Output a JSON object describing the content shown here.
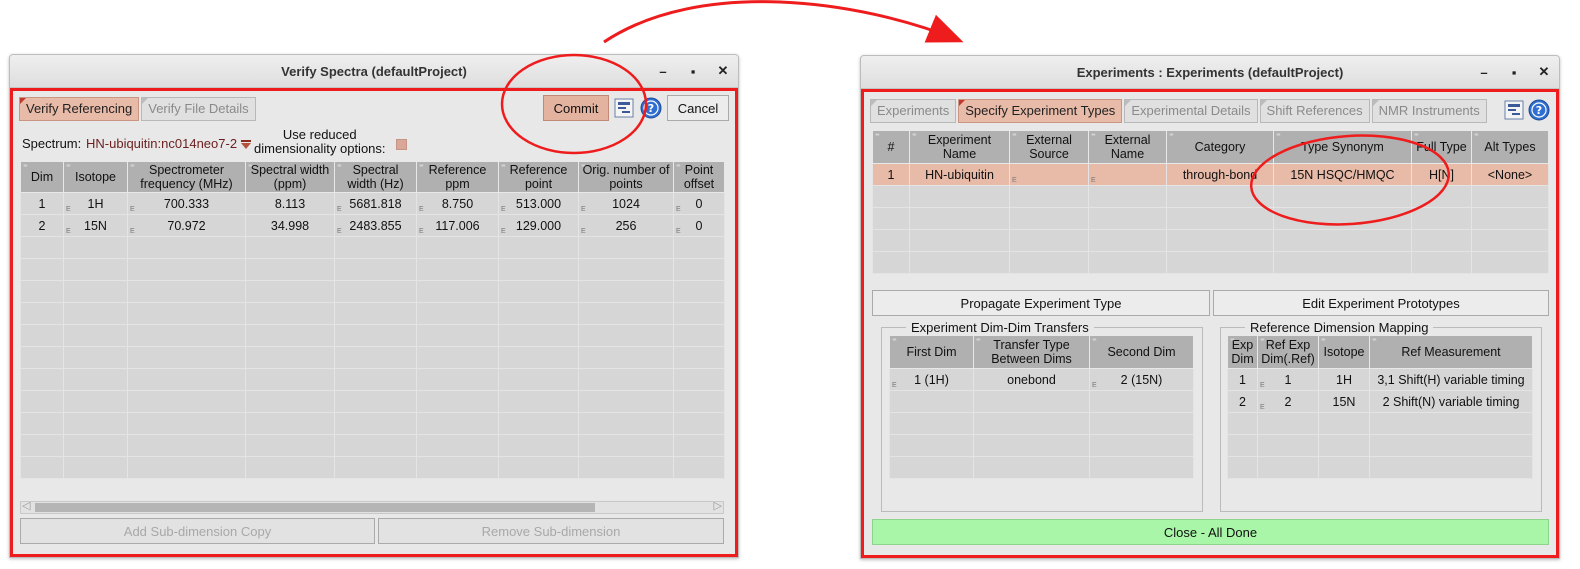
{
  "left": {
    "title": "Verify Spectra (defaultProject)",
    "win_minimize": "–",
    "win_maximize": "▪",
    "win_close": "✕",
    "tabs": [
      "Verify Referencing",
      "Verify File Details"
    ],
    "commit_label": "Commit",
    "cancel_label": "Cancel",
    "spectrum_label": "Spectrum:",
    "spectrum_value": "HN-ubiquitin:nc014neo7-2",
    "reduced_label": "Use reduced\ndimensionality options:",
    "columns": [
      "Dim",
      "Isotope",
      "Spectrometer frequency (MHz)",
      "Spectral width (ppm)",
      "Spectral width (Hz)",
      "Reference ppm",
      "Reference point",
      "Orig. number of points",
      "Point offset"
    ],
    "rows": [
      [
        "1",
        "1H",
        "700.333",
        "8.113",
        "5681.818",
        "8.750",
        "513.000",
        "1024",
        "0"
      ],
      [
        "2",
        "15N",
        "70.972",
        "34.998",
        "2483.855",
        "117.006",
        "129.000",
        "256",
        "0"
      ]
    ],
    "add_subdim_label": "Add Sub-dimension Copy",
    "remove_subdim_label": "Remove Sub-dimension",
    "scroll_left": "◁",
    "scroll_right": "▷"
  },
  "right": {
    "title": "Experiments : Experiments (defaultProject)",
    "win_minimize": "–",
    "win_maximize": "▪",
    "win_close": "✕",
    "tabs": [
      "Experiments",
      "Specify Experiment Types",
      "Experimental Details",
      "Shift References",
      "NMR Instruments"
    ],
    "columns": [
      "#",
      "Experiment Name",
      "External Source",
      "External Name",
      "Category",
      "Type Synonym",
      "Full Type",
      "Alt Types"
    ],
    "rows": [
      [
        "1",
        "HN-ubiquitin",
        "",
        "",
        "through-bond",
        "15N HSQC/HMQC",
        "H[N]",
        "<None>"
      ]
    ],
    "propagate_label": "Propagate Experiment Type",
    "edit_prototypes_label": "Edit Experiment Prototypes",
    "transfers": {
      "legend": "Experiment Dim-Dim Transfers",
      "columns": [
        "First Dim",
        "Transfer Type Between Dims",
        "Second Dim"
      ],
      "rows": [
        [
          "1 (1H)",
          "onebond",
          "2 (15N)"
        ]
      ]
    },
    "mapping": {
      "legend": "Reference Dimension Mapping",
      "columns": [
        "Exp Dim",
        "Ref Exp Dim(.Ref)",
        "Isotope",
        "Ref Measurement"
      ],
      "rows": [
        [
          "1",
          "1",
          "1H",
          "3,1 Shift(H) variable timing"
        ],
        [
          "2",
          "2",
          "15N",
          "2 Shift(N) variable timing"
        ]
      ]
    },
    "close_label": "Close - All Done"
  },
  "colors": {
    "annotation_red": "#ee1c1c",
    "accent_salmon": "#e8baa8",
    "close_green": "#a9f6a9"
  }
}
